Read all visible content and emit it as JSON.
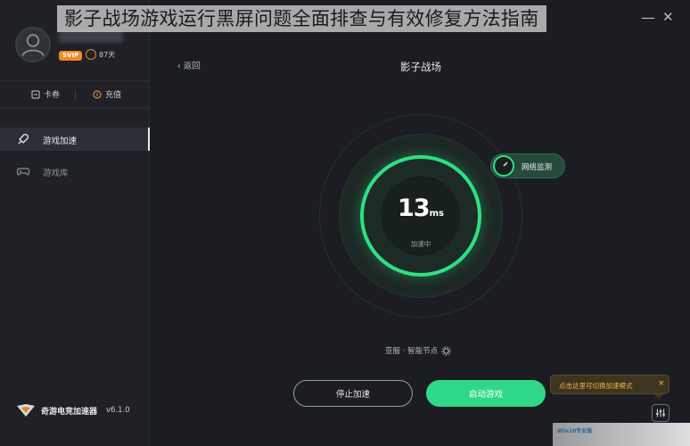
{
  "overlay_title": "影子战场游戏运行黑屏问题全面排查与有效修复方法指南",
  "window": {
    "minimize": "—",
    "close": "✕"
  },
  "profile": {
    "vip": "SVIP",
    "coins": "87天"
  },
  "tickets": {
    "card": "卡券",
    "recharge": "充值"
  },
  "nav": {
    "speed": "游戏加速",
    "library": "游戏库"
  },
  "brand": {
    "name": "奇游电竞加速器",
    "version": "v6.1.0"
  },
  "main": {
    "back": "返回",
    "game_title": "影子战场",
    "latency": "13",
    "latency_unit": "ms",
    "status": "加速中",
    "network_monitor": "网络监测",
    "server": "亚服 · 智能节点",
    "stop_button": "停止加速",
    "start_button": "启动游戏",
    "tooltip": "点击这里可切换加速模式",
    "tooltip_close": "×"
  },
  "watermark": "Win10专业版",
  "colors": {
    "accent": "#2ee084",
    "tooltip_text": "#f2b446",
    "vip": "#f08a24"
  }
}
